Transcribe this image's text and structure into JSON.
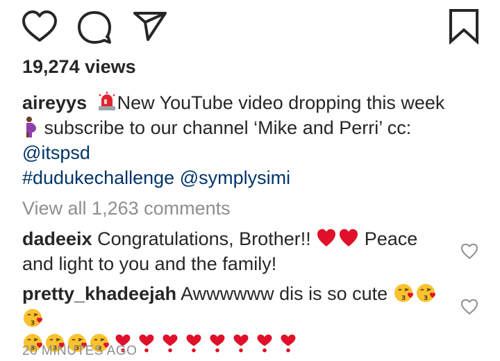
{
  "post": {
    "views": "19,274 views",
    "caption": {
      "username": "aireyys",
      "siren_icon": "police-light-emoji",
      "text_line1": "New YouTube video dropping this week",
      "pregnant_icon": "pregnant-woman-emoji",
      "text_line2": " subscribe to our channel ‘Mike and Perri’ cc:",
      "mention1": "@itspsd",
      "hashtag": "#dudukechallenge",
      "mention2": "@symplysimi"
    },
    "view_comments": "View all 1,263 comments",
    "comments": [
      {
        "username": "dadeeix",
        "text_before": " Congratulations, Brother!! ",
        "text_after": " Peace and light to you and the family!"
      },
      {
        "username": "pretty_khadeejah",
        "text": " Awwwwww dis is so cute "
      }
    ],
    "timestamp": "20 MINUTES AGO"
  },
  "icons": {
    "like": "heart-outline-icon",
    "comment": "comment-bubble-icon",
    "share": "paper-plane-icon",
    "save": "bookmark-icon",
    "comment_like": "small-heart-outline-icon"
  },
  "colors": {
    "text": "#262626",
    "link": "#003569",
    "muted": "#8e8e8e",
    "heart": "#e0102a",
    "kiss_face": "#f9c22e"
  }
}
